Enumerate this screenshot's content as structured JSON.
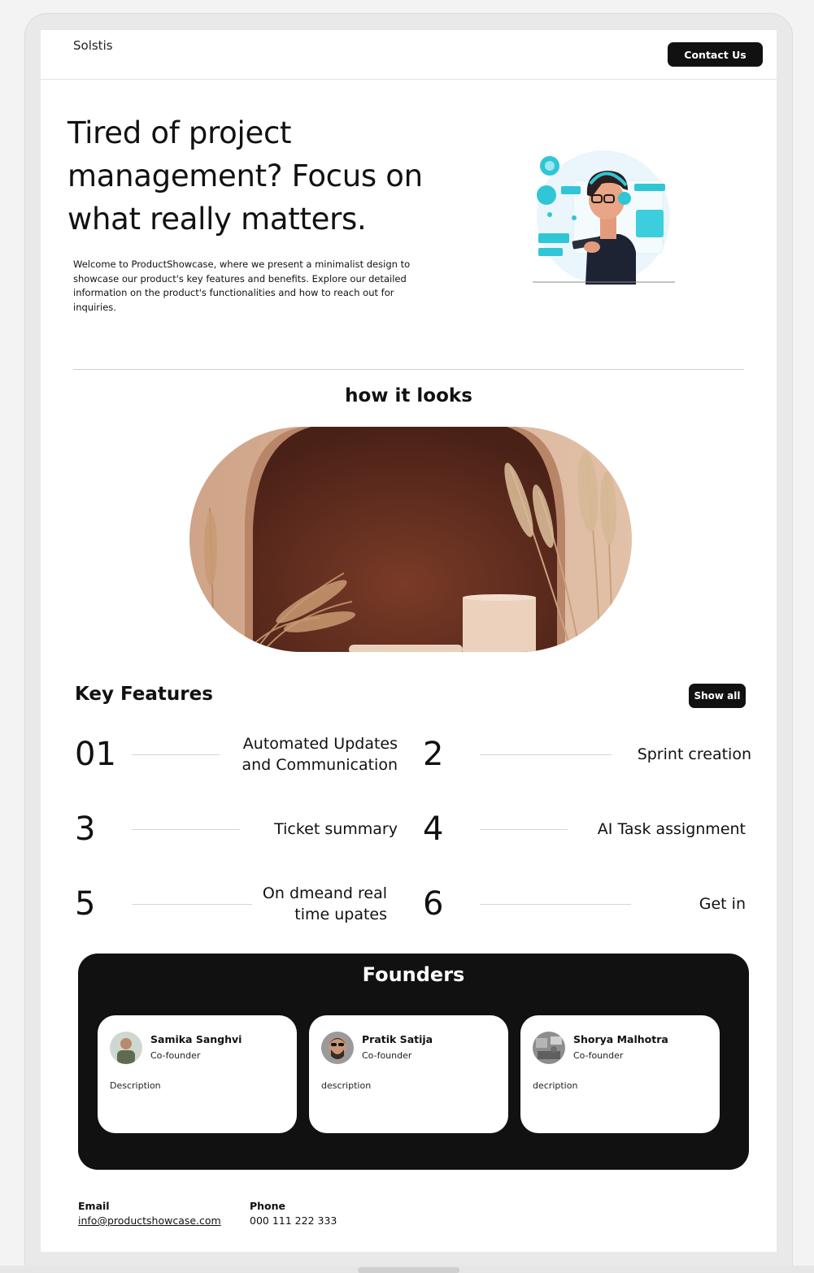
{
  "header": {
    "brand": "Solstis",
    "contact_label": "Contact Us"
  },
  "hero": {
    "title": "Tired of project management? Focus on what really matters.",
    "description": "Welcome to ProductShowcase, where we present a minimalist design to showcase our product's key features and benefits. Explore our detailed information on the product's functionalities and how to reach out for inquiries.",
    "illustration": "person-with-headphones-tablet-illustration"
  },
  "showcase": {
    "title": "how it looks",
    "image": "terracotta-arch-pedestal-pampas-grass-photo"
  },
  "features": {
    "title": "Key Features",
    "show_all_label": "Show all",
    "items": [
      {
        "num": "01",
        "label": "Automated Updates and Communication"
      },
      {
        "num": "2",
        "label": "Sprint creation"
      },
      {
        "num": "3",
        "label": "Ticket summary"
      },
      {
        "num": "4",
        "label": "AI Task assignment"
      },
      {
        "num": "5",
        "label": "On dmeand real time upates"
      },
      {
        "num": "6",
        "label": "Get in"
      }
    ]
  },
  "founders": {
    "title": "Founders",
    "people": [
      {
        "name": "Samika Sanghvi",
        "role": "Co-founder",
        "description": "Description"
      },
      {
        "name": "Pratik Satija",
        "role": "Co-founder",
        "description": "description"
      },
      {
        "name": "Shorya Malhotra",
        "role": "Co-founder",
        "description": "decription"
      }
    ]
  },
  "footer": {
    "email_label": "Email",
    "email_value": "info@productshowcase.com",
    "phone_label": "Phone",
    "phone_value": "000 111 222 333"
  },
  "colors": {
    "accent": "#111111",
    "background": "#ffffff",
    "illustration_accent": "#2cc3d4",
    "showcase_brown": "#5a2a1c"
  }
}
